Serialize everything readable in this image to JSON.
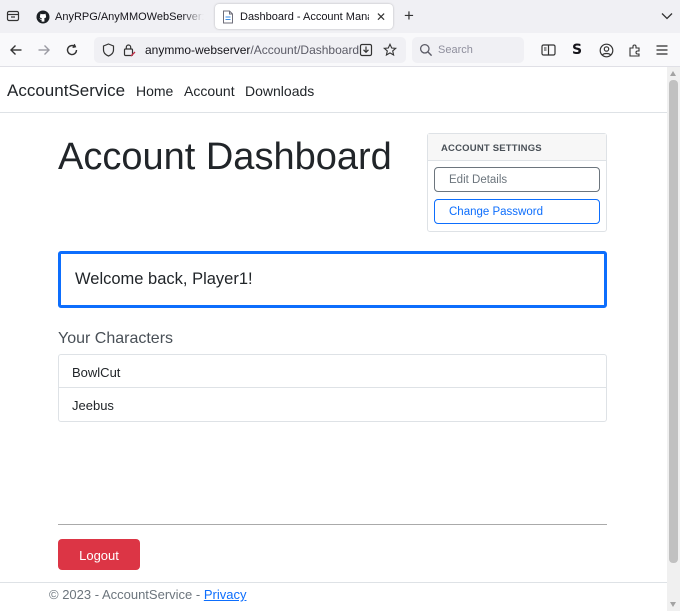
{
  "browser": {
    "tabs": [
      {
        "title": "AnyRPG/AnyMMOWebServer: A",
        "favicon": "github-icon",
        "active": false
      },
      {
        "title": "Dashboard - Account Manager",
        "favicon": "page-icon",
        "active": true
      }
    ],
    "url_host": "anymmo-webserver",
    "url_path": "/Account/Dashboard",
    "search_placeholder": "Search"
  },
  "site": {
    "brand": "AccountService",
    "nav": [
      "Home",
      "Account",
      "Downloads"
    ]
  },
  "dashboard": {
    "title": "Account Dashboard",
    "settings": {
      "heading": "ACCOUNT SETTINGS",
      "edit_label": "Edit Details",
      "password_label": "Change Password"
    },
    "welcome_prefix": "Welcome back, ",
    "player_name": "Player1",
    "welcome_suffix": "!",
    "characters_heading": "Your Characters",
    "characters": [
      "BowlCut",
      "Jeebus"
    ],
    "logout_label": "Logout"
  },
  "footer": {
    "text": "© 2023 - AccountService - ",
    "privacy_label": "Privacy"
  },
  "colors": {
    "primary": "#0d6efd",
    "danger": "#dc3545",
    "secondary": "#6c757d"
  }
}
